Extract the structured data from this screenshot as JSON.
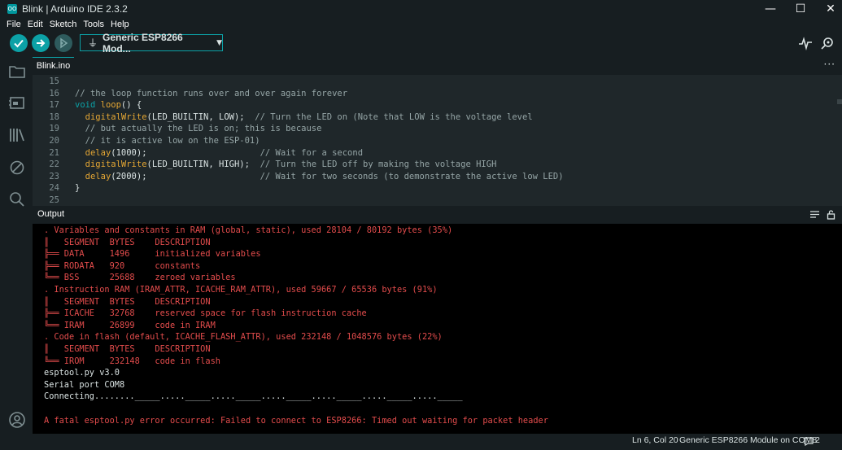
{
  "window": {
    "title": "Blink | Arduino IDE 2.3.2",
    "logo_text": "OO"
  },
  "window_controls": {
    "minimize": "—",
    "maximize": "☐",
    "close": "✕"
  },
  "menu": [
    "File",
    "Edit",
    "Sketch",
    "Tools",
    "Help"
  ],
  "toolbar": {
    "board": "Generic ESP8266 Mod...",
    "colors": {
      "accent": "#0ca1a6",
      "debug_disabled": "#2e5b5d"
    }
  },
  "tabs": [
    {
      "label": "Blink.ino"
    }
  ],
  "tab_more": "···",
  "editor": {
    "lines": [
      {
        "n": "15",
        "segments": []
      },
      {
        "n": "16",
        "segments": [
          {
            "t": "// the loop function runs over and over again forever",
            "c": "cm"
          }
        ]
      },
      {
        "n": "17",
        "segments": [
          {
            "t": "void",
            "c": "kw"
          },
          {
            "t": " ",
            "c": ""
          },
          {
            "t": "loop",
            "c": "fn"
          },
          {
            "t": "() {",
            "c": ""
          }
        ]
      },
      {
        "n": "18",
        "segments": [
          {
            "t": "  ",
            "c": ""
          },
          {
            "t": "digitalWrite",
            "c": "fn"
          },
          {
            "t": "(LED_BUILTIN, LOW);  ",
            "c": ""
          },
          {
            "t": "// Turn the LED on (Note that LOW is the voltage level",
            "c": "cm"
          }
        ]
      },
      {
        "n": "19",
        "segments": [
          {
            "t": "  // but actually the LED is on; this is because",
            "c": "cm"
          }
        ]
      },
      {
        "n": "20",
        "segments": [
          {
            "t": "  // it is active low on the ESP-01)",
            "c": "cm"
          }
        ]
      },
      {
        "n": "21",
        "segments": [
          {
            "t": "  ",
            "c": ""
          },
          {
            "t": "delay",
            "c": "fn"
          },
          {
            "t": "(1000);                      ",
            "c": ""
          },
          {
            "t": "// Wait for a second",
            "c": "cm"
          }
        ]
      },
      {
        "n": "22",
        "segments": [
          {
            "t": "  ",
            "c": ""
          },
          {
            "t": "digitalWrite",
            "c": "fn"
          },
          {
            "t": "(LED_BUILTIN, HIGH);  ",
            "c": ""
          },
          {
            "t": "// Turn the LED off by making the voltage HIGH",
            "c": "cm"
          }
        ]
      },
      {
        "n": "23",
        "segments": [
          {
            "t": "  ",
            "c": ""
          },
          {
            "t": "delay",
            "c": "fn"
          },
          {
            "t": "(2000);                      ",
            "c": ""
          },
          {
            "t": "// Wait for two seconds (to demonstrate the active low LED)",
            "c": "cm"
          }
        ]
      },
      {
        "n": "24",
        "segments": [
          {
            "t": "}",
            "c": ""
          }
        ]
      },
      {
        "n": "25",
        "segments": []
      }
    ]
  },
  "output": {
    "title": "Output",
    "lines": [
      {
        "text": ". Variables and constants in RAM (global, static), used 28104 / 80192 bytes (35%)",
        "kind": "err"
      },
      {
        "text": "║   SEGMENT  BYTES    DESCRIPTION",
        "kind": "err"
      },
      {
        "text": "╠══ DATA     1496     initialized variables",
        "kind": "err"
      },
      {
        "text": "╠══ RODATA   920      constants",
        "kind": "err"
      },
      {
        "text": "╚══ BSS      25688    zeroed variables",
        "kind": "err"
      },
      {
        "text": ". Instruction RAM (IRAM_ATTR, ICACHE_RAM_ATTR), used 59667 / 65536 bytes (91%)",
        "kind": "err"
      },
      {
        "text": "║   SEGMENT  BYTES    DESCRIPTION",
        "kind": "err"
      },
      {
        "text": "╠══ ICACHE   32768    reserved space for flash instruction cache",
        "kind": "err"
      },
      {
        "text": "╚══ IRAM     26899    code in IRAM",
        "kind": "err"
      },
      {
        "text": ". Code in flash (default, ICACHE_FLASH_ATTR), used 232148 / 1048576 bytes (22%)",
        "kind": "err"
      },
      {
        "text": "║   SEGMENT  BYTES    DESCRIPTION",
        "kind": "err"
      },
      {
        "text": "╚══ IROM     232148   code in flash",
        "kind": "err"
      },
      {
        "text": "esptool.py v3.0",
        "kind": "ok"
      },
      {
        "text": "Serial port COM8",
        "kind": "ok"
      },
      {
        "text": "Connecting........_____....._____....._____....._____....._____....._____....._____",
        "kind": "ok"
      },
      {
        "text": "",
        "kind": "ok"
      },
      {
        "text": "A fatal esptool.py error occurred: Failed to connect to ESP8266: Timed out waiting for packet header",
        "kind": "err"
      }
    ]
  },
  "status": {
    "cursor": "Ln 6, Col 20",
    "board_port": "Generic ESP8266 Module on COM8",
    "notifications": "2"
  }
}
